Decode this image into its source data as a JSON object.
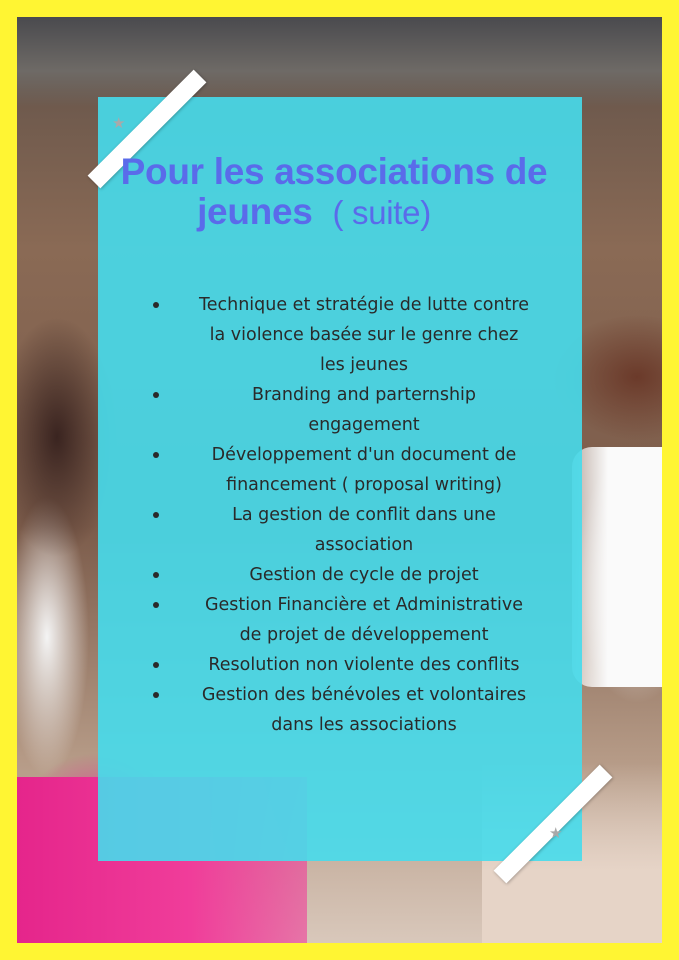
{
  "title": {
    "line1": "Pour les associations de",
    "line2_main": "jeunes",
    "line2_suffix": "( suite)"
  },
  "items": [
    {
      "lines": [
        "Technique et stratégie de lutte contre",
        "la violence basée sur le genre chez",
        "les jeunes"
      ]
    },
    {
      "lines": [
        "Branding and parternship",
        "engagement"
      ]
    },
    {
      "lines": [
        "Développement d'un document de",
        "financement ( proposal writing)"
      ]
    },
    {
      "lines": [
        "La gestion de conflit dans une",
        "association"
      ]
    },
    {
      "lines": [
        "Gestion de cycle de projet"
      ]
    },
    {
      "lines": [
        "Gestion Financière et Administrative",
        "de projet de développement"
      ]
    },
    {
      "lines": [
        "Resolution non violente des conflits"
      ]
    },
    {
      "lines": [
        "Gestion des bénévoles et volontaires",
        "dans les associations"
      ]
    }
  ],
  "colors": {
    "frame": "#FFF533",
    "panel": "#46DCEC",
    "title": "#5A6BEA",
    "text": "#2A2A2A"
  },
  "icons": [
    "star-icon"
  ]
}
